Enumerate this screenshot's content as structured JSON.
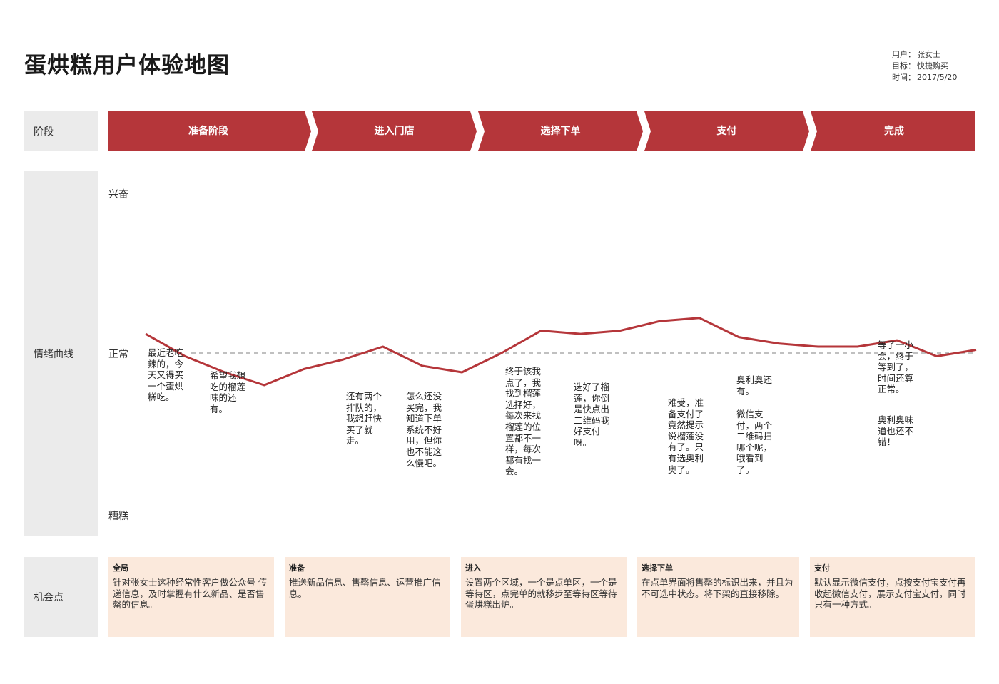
{
  "title": "蛋烘糕用户体验地图",
  "meta": {
    "user_label": "用户：",
    "user": "张女士",
    "goal_label": "目标：",
    "goal": "快捷购买",
    "time_label": "时间：",
    "time": "2017/5/20"
  },
  "rows": {
    "stage": "阶段",
    "curve": "情绪曲线",
    "opportunity": "机会点"
  },
  "stages": [
    "准备阶段",
    "进入门店",
    "选择下单",
    "支付",
    "完成"
  ],
  "levels": {
    "high": "兴奋",
    "normal": "正常",
    "low": "糟糕"
  },
  "emotion_curve": {
    "scale": "0 = 糟糕, 50 = 正常, 100 = 兴奋",
    "values": [
      56,
      49,
      44,
      40,
      45,
      48,
      52,
      46,
      44,
      50,
      57,
      56,
      57,
      60,
      61,
      55,
      53,
      52,
      52,
      54,
      49,
      51
    ]
  },
  "notes": [
    "最近老吃\n辣的，今\n天又得买\n一个蛋烘\n糕吃。",
    "希望我想\n吃的榴莲\n味的还\n有。",
    "还有两个\n排队的，\n我想赶快\n买了就\n走。",
    "怎么还没\n买完，我\n知道下单\n系统不好\n用，但你\n也不能这\n么慢吧。",
    "终于该我\n点了，我\n找到榴莲\n选择好，\n每次来找\n榴莲的位\n置都不一\n样，每次\n都有找一\n会。",
    "选好了榴\n莲，你倒\n是快点出\n二维码我\n好支付\n呀。",
    "难受，准\n备支付了\n竟然提示\n说榴莲没\n有了。只\n有选奥利\n奥了。",
    "奥利奥还\n有。",
    "微信支\n付，两个\n二维码扫\n哪个呢，\n哦看到\n了。",
    "等了一小\n会，终于\n等到了，\n时间还算\n正常。",
    "奥利奥味\n道也还不\n错！"
  ],
  "opportunities": [
    {
      "title": "全局",
      "text": "针对张女士这种经常性客户做公众号 传递信息，及时掌握有什么新品、是否售罄的信息。"
    },
    {
      "title": "准备",
      "text": "推送新品信息、售罄信息、运营推广信息。"
    },
    {
      "title": "进入",
      "text": "设置两个区域，一个是点单区，一个是等待区，点完单的就移步至等待区等待蛋烘糕出炉。"
    },
    {
      "title": "选择下单",
      "text": "在点单界面将售罄的标识出来，并且为不可选中状态。将下架的直接移除。"
    },
    {
      "title": "支付",
      "text": "默认显示微信支付，点按支付宝支付再收起微信支付，展示支付宝支付，同时只有一种方式。"
    }
  ],
  "colors": {
    "accent": "#b5363a",
    "label_bg": "#ebebeb",
    "opportunity_bg": "#fbe9dc",
    "baseline": "#9a9a9a"
  }
}
